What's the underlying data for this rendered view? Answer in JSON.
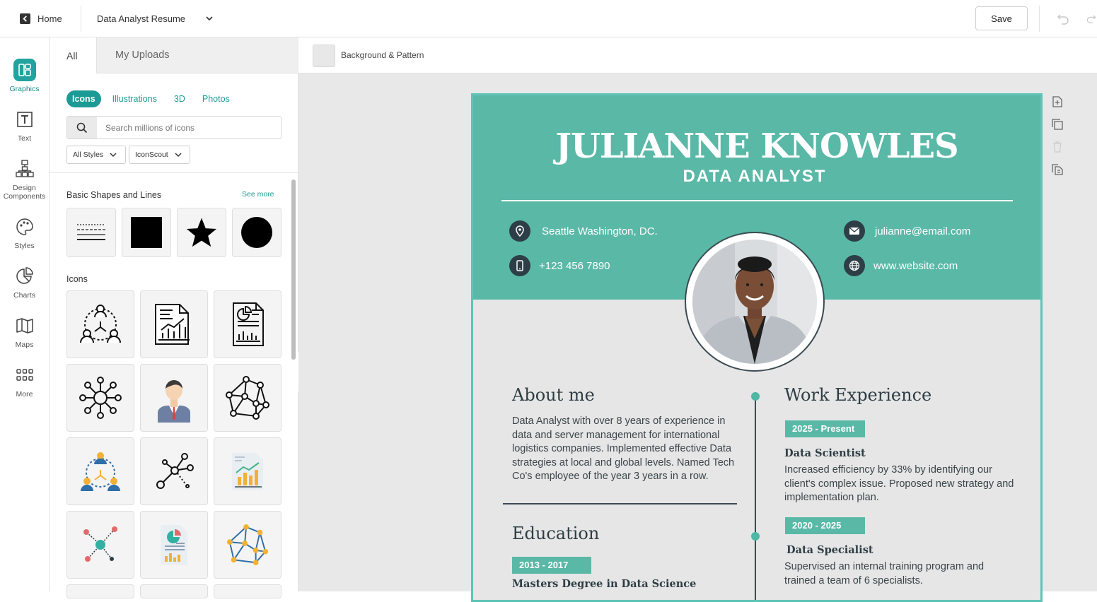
{
  "topbar": {
    "home_label": "Home",
    "doc_title": "Data Analyst Resume",
    "save_label": "Save"
  },
  "rail": [
    {
      "label": "Graphics",
      "icon": "graphics-icon"
    },
    {
      "label": "Text",
      "icon": "text-icon"
    },
    {
      "label": "Design\nComponents",
      "icon": "design-components-icon"
    },
    {
      "label": "Styles",
      "icon": "palette-icon"
    },
    {
      "label": "Charts",
      "icon": "chart-icon"
    },
    {
      "label": "Maps",
      "icon": "map-icon"
    },
    {
      "label": "More",
      "icon": "grid-icon"
    }
  ],
  "panel": {
    "tabs": [
      "All",
      "My Uploads"
    ],
    "chips": [
      "Icons",
      "Illustrations",
      "3D",
      "Photos"
    ],
    "search_placeholder": "Search millions of icons",
    "filters": [
      "All Styles",
      "IconScout"
    ],
    "shapes_title": "Basic Shapes and Lines",
    "see_more": "See more",
    "icons_title": "Icons"
  },
  "canvas_toolbar": {
    "background_label": "Background & Pattern"
  },
  "resume": {
    "name": "JULIANNE KNOWLES",
    "role": "DATA ANALYST",
    "location": "Seattle Washington, DC.",
    "phone": "+123 456 7890",
    "email": "julianne@email.com",
    "website": "www.website.com",
    "about_title": "About me",
    "about_text": "Data Analyst with over 8 years of experience in data and server management for international logistics companies. Implemented effective Data strategies at local and global levels. Named Tech Co's employee of the year 3 years in a row.",
    "education_title": "Education",
    "edu_period": "2013 - 2017",
    "edu_degree": "Masters Degree in Data Science",
    "work_title": "Work Experience",
    "job1_period": "2025 - Present",
    "job1_title": "Data Scientist",
    "job1_text": "Increased efficiency by 33% by identifying our client's complex issue. Proposed new strategy and implementation plan.",
    "job2_period": "2020 - 2025",
    "job2_title": "Data Specialist",
    "job2_text": "Supervised an internal training program and trained a team of 6 specialists."
  },
  "colors": {
    "accent": "#1b9a96",
    "resume_teal": "#5ab8a7",
    "dark": "#2d3e46"
  }
}
